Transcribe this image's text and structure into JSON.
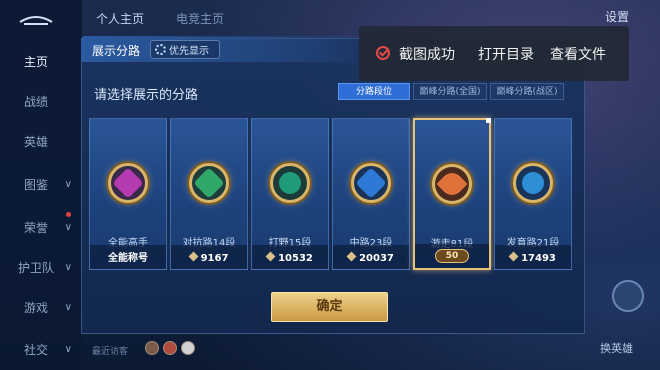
{
  "nav": {
    "items": [
      {
        "label": "主页",
        "active": true
      },
      {
        "label": "战绩"
      },
      {
        "label": "英雄"
      },
      {
        "label": "图鉴"
      },
      {
        "label": "荣誉"
      },
      {
        "label": "护卫队"
      },
      {
        "label": "游戏"
      },
      {
        "label": "社交"
      }
    ]
  },
  "top_tabs": [
    "个人主页",
    "电竞主页"
  ],
  "settings_label": "设置",
  "right_side_label": "换英雄",
  "panel": {
    "title": "展示分路",
    "priority_button": "优先显示",
    "prompt": "请选择展示的分路",
    "segments": [
      {
        "label": "分路段位",
        "active": true
      },
      {
        "label": "巅峰分路(全国)"
      },
      {
        "label": "巅峰分路(战区)"
      }
    ],
    "cards": [
      {
        "label": "全能高手",
        "value": "全能称号",
        "color": "#b63bb0",
        "icon": "crossed-swords-icon"
      },
      {
        "label": "对抗路14段",
        "value": "9167",
        "color": "#2fa86a",
        "icon": "shield-x-icon"
      },
      {
        "label": "打野15段",
        "value": "10532",
        "color": "#1f9a7a",
        "icon": "dragon-icon"
      },
      {
        "label": "中路23段",
        "value": "20037",
        "color": "#2e79d6",
        "icon": "staff-icon"
      },
      {
        "label": "游走81段",
        "value": "50",
        "color": "#e0703a",
        "icon": "wings-icon",
        "selected": true
      },
      {
        "label": "发育路21段",
        "value": "17493",
        "color": "#2e8fd6",
        "icon": "target-icon"
      }
    ],
    "confirm_label": "确定",
    "recent_label": "最近访客"
  },
  "toast": {
    "message": "截图成功",
    "open_dir": "打开目录",
    "view_file": "查看文件"
  },
  "colors": {
    "accent": "#2f6ed6",
    "gold": "#e6c27a",
    "toast_check": "#e84848"
  }
}
